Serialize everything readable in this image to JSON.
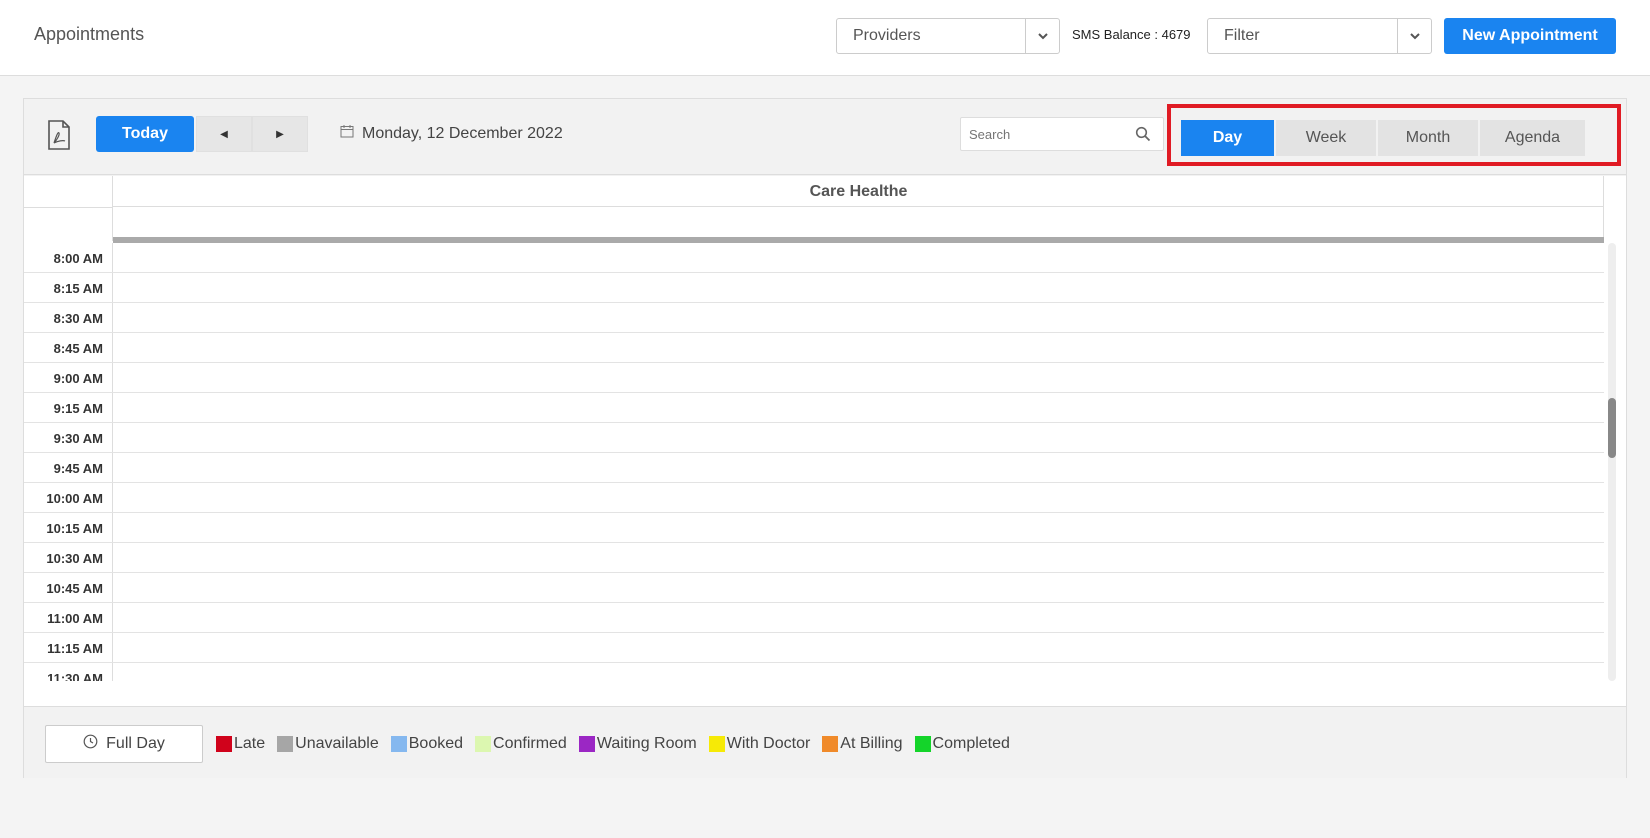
{
  "header": {
    "title": "Appointments",
    "providers_select": "Providers",
    "sms_balance": "SMS Balance : 4679",
    "filter_select": "Filter",
    "new_appointment": "New Appointment"
  },
  "toolbar": {
    "today": "Today",
    "date": "Monday, 12 December 2022",
    "search_placeholder": "Search",
    "views": [
      "Day",
      "Week",
      "Month",
      "Agenda"
    ],
    "active_view": "Day"
  },
  "scheduler": {
    "resource": "Care Healthe",
    "times": [
      "8:00 AM",
      "8:15 AM",
      "8:30 AM",
      "8:45 AM",
      "9:00 AM",
      "9:15 AM",
      "9:30 AM",
      "9:45 AM",
      "10:00 AM",
      "10:15 AM",
      "10:30 AM",
      "10:45 AM",
      "11:00 AM",
      "11:15 AM",
      "11:30 AM"
    ]
  },
  "legend": {
    "full_day": "Full Day",
    "items": [
      {
        "label": "Late",
        "color": "#d0021b"
      },
      {
        "label": "Unavailable",
        "color": "#a6a6a6"
      },
      {
        "label": "Booked",
        "color": "#85b8ef"
      },
      {
        "label": "Confirmed",
        "color": "#dcf7b0"
      },
      {
        "label": "Waiting Room",
        "color": "#9b27c4"
      },
      {
        "label": "With Doctor",
        "color": "#f6ea06"
      },
      {
        "label": "At Billing",
        "color": "#f08a2a"
      },
      {
        "label": "Completed",
        "color": "#14d42a"
      }
    ]
  },
  "colors": {
    "primary": "#1a84f0",
    "highlight": "#e01b24"
  }
}
